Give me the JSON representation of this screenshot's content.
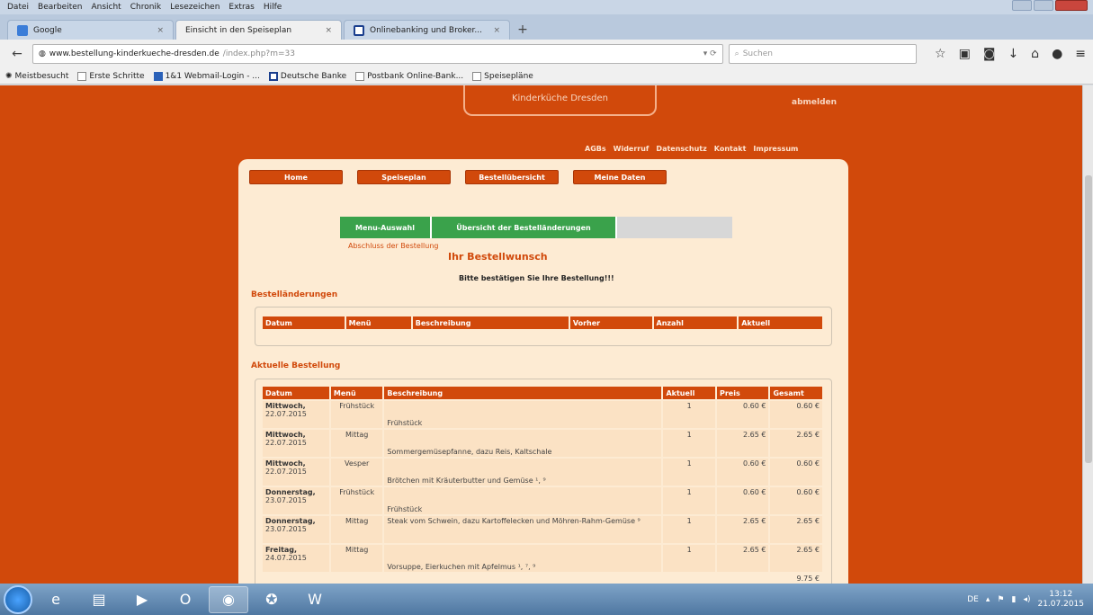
{
  "window": {
    "menu": [
      "Datei",
      "Bearbeiten",
      "Ansicht",
      "Chronik",
      "Lesezeichen",
      "Extras",
      "Hilfe"
    ]
  },
  "tabs": [
    {
      "label": "Google"
    },
    {
      "label": "Einsicht in den Speiseplan"
    },
    {
      "label": "Onlinebanking und Broker..."
    }
  ],
  "nav": {
    "url_domain": "www.bestellung-kinderkueche-dresden.de",
    "url_path": "/index.php?m=33",
    "search_placeholder": "Suchen"
  },
  "bookmarks": [
    "Meistbesucht",
    "Erste Schritte",
    "1&1 Webmail-Login - ...",
    "Deutsche Banke",
    "Postbank Online-Bank...",
    "Speisepläne"
  ],
  "site": {
    "logo_text": "Kinderküche Dresden",
    "abmelden": "abmelden",
    "top_links": [
      "AGBs",
      "Widerruf",
      "Datenschutz",
      "Kontakt",
      "Impressum"
    ],
    "main_nav": [
      "Home",
      "Speiseplan",
      "Bestellübersicht",
      "Meine Daten"
    ],
    "steps": [
      "Menu-Auswahl",
      "Übersicht der Bestelländerungen",
      ""
    ],
    "step_subtitle": "Abschluss der Bestellung",
    "wish_title": "Ihr Bestellwunsch",
    "confirm_text": "Bitte bestätigen Sie Ihre Bestellung!!!"
  },
  "changes": {
    "title": "Bestelländerungen",
    "headers": [
      "Datum",
      "Menü",
      "Beschreibung",
      "Vorher",
      "Anzahl",
      "Aktuell"
    ]
  },
  "current": {
    "title": "Aktuelle Bestellung",
    "headers": [
      "Datum",
      "Menü",
      "Beschreibung",
      "Aktuell",
      "Preis",
      "Gesamt"
    ],
    "rows": [
      {
        "day": "Mittwoch,",
        "date": "22.07.2015",
        "menu": "Frühstück",
        "desc": "Frühstück",
        "qty": "1",
        "price": "0.60 €",
        "total": "0.60 €"
      },
      {
        "day": "Mittwoch,",
        "date": "22.07.2015",
        "menu": "Mittag",
        "desc": "Sommergemüsepfanne, dazu Reis, Kaltschale",
        "qty": "1",
        "price": "2.65 €",
        "total": "2.65 €"
      },
      {
        "day": "Mittwoch,",
        "date": "22.07.2015",
        "menu": "Vesper",
        "desc": "Brötchen mit Kräuterbutter und Gemüse ¹, ⁹",
        "qty": "1",
        "price": "0.60 €",
        "total": "0.60 €"
      },
      {
        "day": "Donnerstag,",
        "date": "23.07.2015",
        "menu": "Frühstück",
        "desc": "Frühstück",
        "qty": "1",
        "price": "0.60 €",
        "total": "0.60 €"
      },
      {
        "day": "Donnerstag,",
        "date": "23.07.2015",
        "menu": "Mittag",
        "desc": "Steak vom Schwein, dazu Kartoffelecken und Möhren-Rahm-Gemüse ⁹",
        "qty": "1",
        "price": "2.65 €",
        "total": "2.65 €"
      },
      {
        "day": "Freitag,",
        "date": "24.07.2015",
        "menu": "Mittag",
        "desc": "Vorsuppe, Eierkuchen mit Apfelmus ¹, ⁷, ⁹",
        "qty": "1",
        "price": "2.65 €",
        "total": "2.65 €"
      }
    ],
    "sum": "9.75 €"
  },
  "taskbar": {
    "lang": "DE",
    "time": "13:12",
    "date": "21.07.2015"
  }
}
